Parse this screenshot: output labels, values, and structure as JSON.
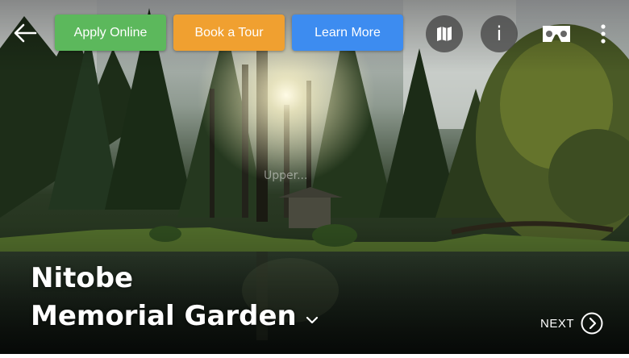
{
  "header": {
    "back_icon": "arrow-left-icon",
    "buttons": [
      {
        "label": "Apply Online",
        "color": "#5cb85c"
      },
      {
        "label": "Book a Tour",
        "color": "#f0a030"
      },
      {
        "label": "Learn More",
        "color": "#3d8cf0"
      }
    ],
    "icons": [
      "map-icon",
      "info-icon",
      "vr-headset-icon",
      "more-vertical-icon"
    ],
    "info_glyph": "i"
  },
  "hotspot": {
    "label": "Upper..."
  },
  "location": {
    "title_line1": "Nitobe",
    "title_line2": "Memorial Garden"
  },
  "footer": {
    "next_label": "NEXT"
  }
}
